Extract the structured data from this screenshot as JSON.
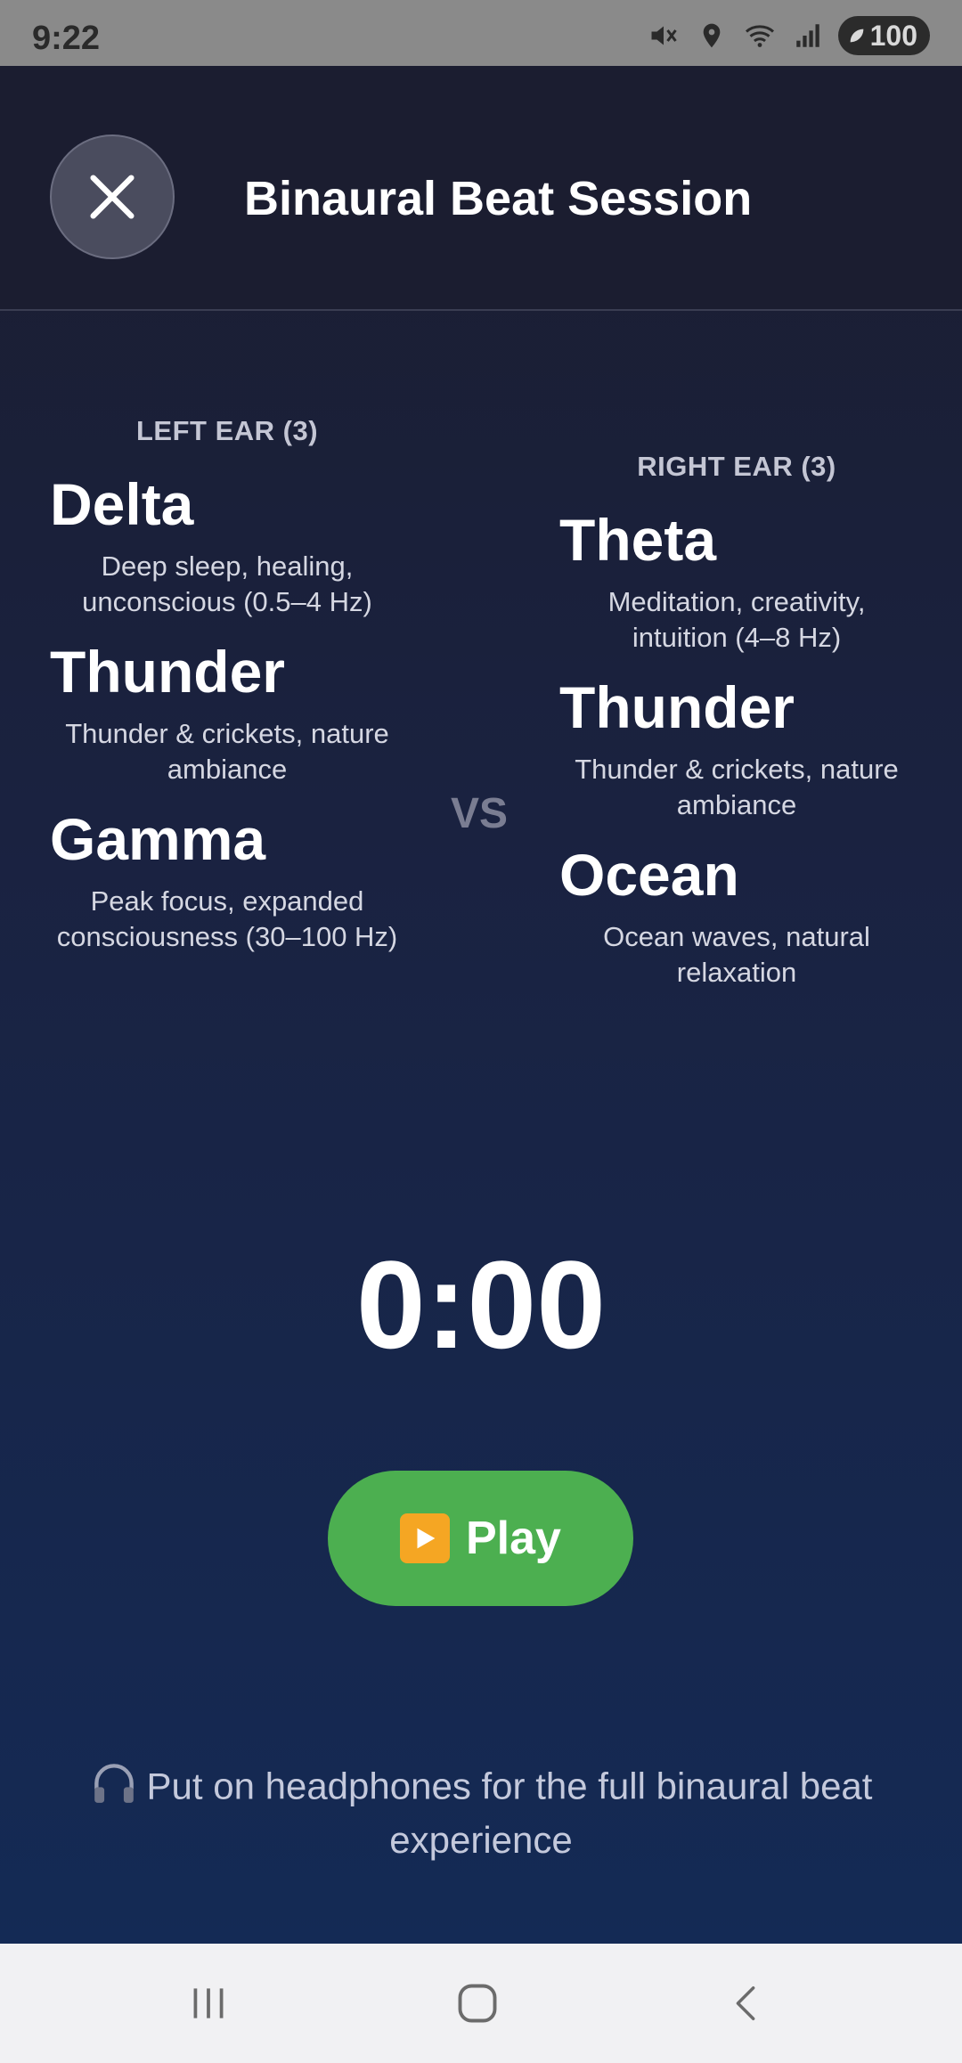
{
  "status_bar": {
    "time": "9:22",
    "battery": "100",
    "icons": [
      "mute-icon",
      "location-icon",
      "wifi-icon",
      "signal-icon",
      "battery-icon"
    ]
  },
  "header": {
    "title": "Binaural Beat Session",
    "close_icon": "close-icon"
  },
  "left_ear": {
    "label": "LEFT EAR (3)",
    "choices": [
      {
        "name": "Delta",
        "description": "Deep sleep, healing, unconscious (0.5–4 Hz)"
      },
      {
        "name": "Thunder",
        "description": "Thunder & crickets, nature ambiance"
      },
      {
        "name": "Gamma",
        "description": "Peak focus, expanded consciousness (30–100 Hz)"
      }
    ]
  },
  "right_ear": {
    "label": "RIGHT EAR (3)",
    "choices": [
      {
        "name": "Theta",
        "description": "Meditation, creativity, intuition (4–8 Hz)"
      },
      {
        "name": "Thunder",
        "description": "Thunder & crickets, nature ambiance"
      },
      {
        "name": "Ocean",
        "description": "Ocean waves, natural relaxation"
      }
    ]
  },
  "vs_label": "VS",
  "timer": "0:00",
  "play_button": {
    "label": "Play",
    "icon": "play-icon"
  },
  "hint": {
    "text": "Put on headphones for the full binaural beat experience",
    "icon": "headphones-icon"
  },
  "colors": {
    "background": "#1b1d30",
    "play_button": "#4caf50",
    "accent_text": "#ffffff"
  },
  "nav_bar": {
    "icons": [
      "recent-apps-icon",
      "home-icon",
      "back-icon"
    ]
  }
}
